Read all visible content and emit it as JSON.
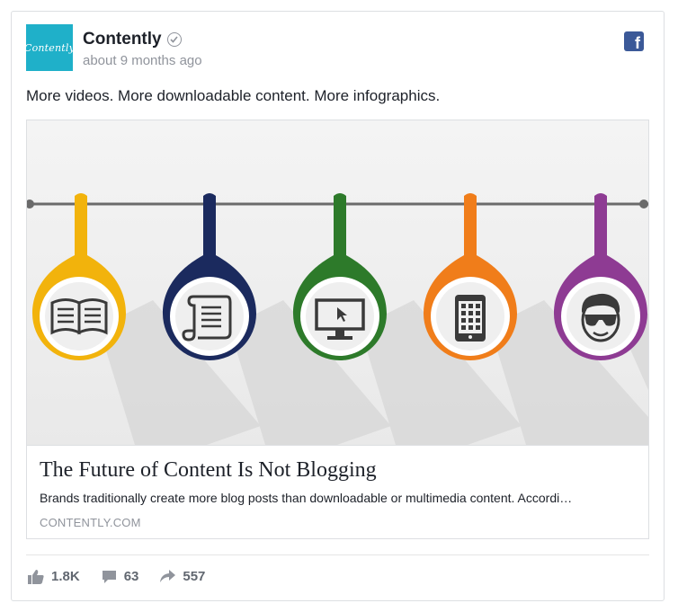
{
  "post": {
    "logo_text": "Contently",
    "page_name": "Contently",
    "timestamp": "about 9 months ago",
    "message": "More videos. More downloadable content. More infographics.",
    "network_icon": "facebook-icon"
  },
  "link": {
    "title": "The Future of Content Is Not Blogging",
    "description": "Brands traditionally create more blog posts than downloadable or multimedia content. Accordi…",
    "domain": "CONTENTLY.COM",
    "image_pendants": [
      {
        "icon": "book-icon",
        "color": "#f2b30c"
      },
      {
        "icon": "scroll-icon",
        "color": "#1b2a5e"
      },
      {
        "icon": "monitor-icon",
        "color": "#2d7a2a"
      },
      {
        "icon": "tablet-icon",
        "color": "#f07d1a"
      },
      {
        "icon": "person-sunglasses-icon",
        "color": "#8e3b93"
      }
    ]
  },
  "stats": {
    "likes": "1.8K",
    "comments": "63",
    "shares": "557"
  }
}
